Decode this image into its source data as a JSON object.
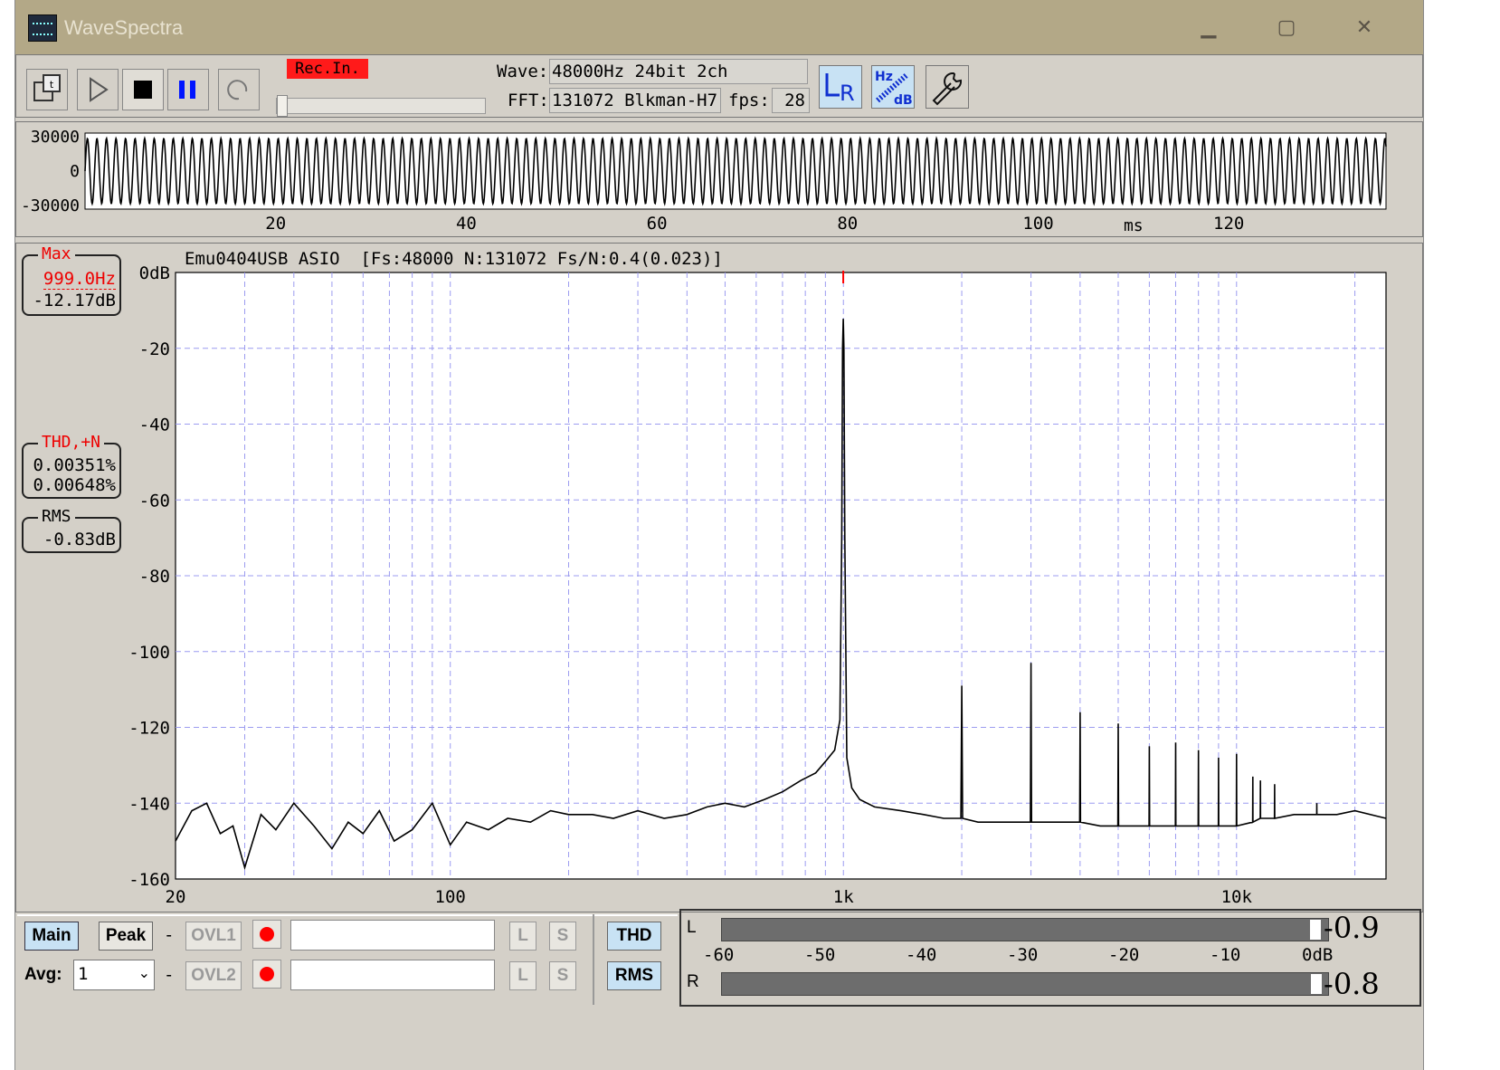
{
  "window": {
    "title": "WaveSpectra",
    "minimize_glyph": "▁",
    "maximize_glyph": "▢",
    "close_glyph": "✕"
  },
  "toolbar": {
    "rec_in": "Rec.In.",
    "wave_label": "Wave:",
    "wave_value": "48000Hz 24bit 2ch",
    "fft_label": "FFT:",
    "fft_value": "131072 Blkman-H7",
    "fps_label": "fps:",
    "fps_value": "28",
    "icons": [
      "export-icon",
      "play-icon",
      "stop-icon",
      "pause-icon",
      "loop-icon",
      "lr-icon",
      "hz-db-icon",
      "wrench-icon"
    ],
    "lr_text": "LR",
    "hz_text": "Hz",
    "db_text": "dB"
  },
  "waveform": {
    "y_ticks": [
      "30000",
      "0",
      "-30000"
    ],
    "x_ticks": [
      "20",
      "40",
      "60",
      "80",
      "100",
      "120"
    ],
    "x_unit": "ms"
  },
  "spectrum": {
    "header": "Emu0404USB ASIO  [Fs:48000 N:131072 Fs/N:0.4(0.023)]",
    "y_ticks": [
      "0dB",
      "-20",
      "-40",
      "-60",
      "-80",
      "-100",
      "-120",
      "-140",
      "-160"
    ],
    "x_ticks": [
      "20",
      "100",
      "1k",
      "10k"
    ]
  },
  "readouts": {
    "max_title": "Max",
    "max_freq": "999.0Hz",
    "max_level": "-12.17dB",
    "thd_title": "THD,+N",
    "thd_value": "0.00351%",
    "thdn_value": "0.00648%",
    "rms_title": "RMS",
    "rms_value": "-0.83dB"
  },
  "bottom": {
    "main": "Main",
    "peak": "Peak",
    "dash": "-",
    "ovl1": "OVL1",
    "ovl2": "OVL2",
    "l": "L",
    "s": "S",
    "avg_label": "Avg:",
    "avg_value": "1",
    "thd": "THD",
    "rms": "RMS"
  },
  "meter": {
    "l_label": "L",
    "r_label": "R",
    "l_value": "-0.9",
    "r_value": "-0.8",
    "scale": [
      "-60",
      "-50",
      "-40",
      "-30",
      "-20",
      "-10",
      "0dB"
    ],
    "l_level_db": -0.9,
    "r_level_db": -0.8
  },
  "colors": {
    "accent_red": "#ff0000",
    "grid": "#9c9cf0",
    "button_blue": "#c8e2f4"
  },
  "chart_data": {
    "type": "line",
    "title": "",
    "xlabel": "",
    "ylabel": "",
    "x_scale": "log",
    "xlim": [
      20,
      24000
    ],
    "ylim": [
      -160,
      0
    ],
    "grid": true,
    "series": [
      {
        "x": [
          20,
          22,
          24,
          26,
          28,
          30,
          33,
          36,
          40,
          45,
          50,
          55,
          60,
          66,
          72,
          80,
          90,
          100,
          110,
          125,
          140,
          160,
          180,
          200,
          230,
          260,
          300,
          350,
          400,
          450,
          500,
          560,
          630,
          700,
          780,
          850,
          900,
          950,
          980,
          990,
          995,
          999,
          1003,
          1008,
          1020,
          1050,
          1100,
          1200,
          1400,
          1600,
          1800,
          1990,
          2000,
          2010,
          2200,
          2500,
          2800,
          2990,
          3000,
          3010,
          3500,
          3990,
          4000,
          4010,
          4500,
          4990,
          5000,
          5010,
          5500,
          5990,
          6000,
          6010,
          6500,
          6990,
          7000,
          7010,
          7500,
          7990,
          8000,
          8010,
          8500,
          8990,
          9000,
          9010,
          9500,
          9990,
          10000,
          10010,
          10990,
          11000,
          11010,
          11490,
          11500,
          11510,
          12000,
          12490,
          12500,
          12510,
          14000,
          15990,
          16000,
          16010,
          18000,
          20000,
          24000
        ],
        "y": [
          -150,
          -142,
          -140,
          -148,
          -146,
          -157,
          -143,
          -147,
          -140,
          -146,
          -152,
          -145,
          -148,
          -142,
          -150,
          -147,
          -140,
          -151,
          -145,
          -147,
          -144,
          -145,
          -142,
          -143,
          -143,
          -144,
          -142,
          -144,
          -143,
          -141,
          -140,
          -141,
          -139,
          -137,
          -134,
          -132,
          -129,
          -126,
          -118,
          -70,
          -20,
          -12.2,
          -20,
          -70,
          -128,
          -136,
          -139,
          -141,
          -142,
          -143,
          -144,
          -144,
          -109,
          -144,
          -145,
          -145,
          -145,
          -145,
          -103,
          -145,
          -145,
          -145,
          -116,
          -145,
          -146,
          -146,
          -119,
          -146,
          -146,
          -146,
          -125,
          -146,
          -146,
          -146,
          -124,
          -146,
          -146,
          -146,
          -126,
          -146,
          -146,
          -146,
          -128,
          -146,
          -146,
          -146,
          -127,
          -146,
          -145,
          -133,
          -145,
          -144,
          -134,
          -144,
          -144,
          -144,
          -135,
          -144,
          -143,
          -143,
          -140,
          -143,
          -143,
          -142,
          -144
        ]
      }
    ]
  }
}
